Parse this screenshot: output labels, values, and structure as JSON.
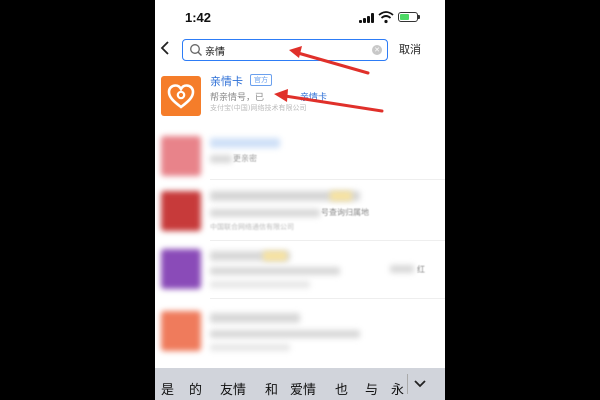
{
  "status_bar": {
    "time": "1:42"
  },
  "search": {
    "query": "亲情",
    "cancel_label": "取消"
  },
  "results": [
    {
      "title": "亲情卡",
      "badge": "官方",
      "desc_parts": [
        "帮亲情号，已",
        "亲情卡"
      ],
      "sub": "支付宝(中国)网络技术有限公司"
    }
  ],
  "blurred_fragments": {
    "row2_line": "更亲密",
    "row3_line": "号查询归属地",
    "row3_sub": "中国联合网络通信有限公司",
    "row4_tail": "红"
  },
  "keyboard": {
    "candidates": [
      "是",
      "的",
      "友情",
      "和",
      "爱情",
      "也",
      "与",
      "永"
    ]
  },
  "colors": {
    "accent": "#2d7cf6",
    "annotation": "#e0302a",
    "icon_orange": "#f57d2a"
  }
}
